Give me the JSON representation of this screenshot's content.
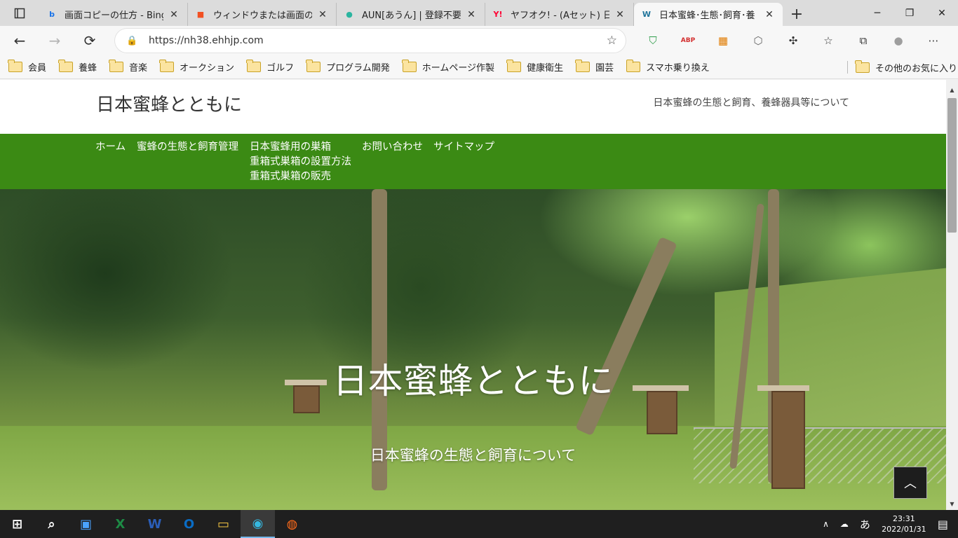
{
  "browser": {
    "tabs": [
      {
        "title": "画面コピーの仕方 - Bing",
        "fav": "b",
        "fav_color": "#1a73e8",
        "active": false
      },
      {
        "title": "ウィンドウまたは画面の内容",
        "fav": "■",
        "fav_color": "#f25022",
        "active": false
      },
      {
        "title": "AUN[あうん] | 登録不要",
        "fav": "●",
        "fav_color": "#2bb5a0",
        "active": false
      },
      {
        "title": "ヤフオク! - (Aセット) 日本",
        "fav": "Y!",
        "fav_color": "#ff0033",
        "active": false
      },
      {
        "title": "日本蜜蜂･生態･飼育･養",
        "fav": "W",
        "fav_color": "#21759b",
        "active": true
      }
    ],
    "new_tab": "+",
    "window_controls": {
      "minimize": "─",
      "restore": "❐",
      "close": "✕"
    },
    "nav": {
      "back": "←",
      "forward": "→",
      "reload": "⟳"
    },
    "url": "https://nh38.ehhjp.com",
    "lock": "🔒",
    "add_favorite": "☆",
    "extensions": [
      {
        "name": "shield-icon",
        "glyph": "⛉",
        "color": "#2e9d4a"
      },
      {
        "name": "abp-icon",
        "glyph": "ABP",
        "color": "#d32f2f"
      },
      {
        "name": "cube-icon",
        "glyph": "▦",
        "color": "#e07b00"
      },
      {
        "name": "hexagon-icon",
        "glyph": "⬡",
        "color": "#666"
      },
      {
        "name": "puzzle-icon",
        "glyph": "✣",
        "color": "#333"
      },
      {
        "name": "favorites-icon",
        "glyph": "☆",
        "color": "#333"
      },
      {
        "name": "collections-icon",
        "glyph": "⧉",
        "color": "#333"
      },
      {
        "name": "profile-icon",
        "glyph": "●",
        "color": "#9e9e9e"
      },
      {
        "name": "more-icon",
        "glyph": "⋯",
        "color": "#333"
      }
    ],
    "bookmarks": [
      "会員",
      "養蜂",
      "音楽",
      "オークション",
      "ゴルフ",
      "プログラム開発",
      "ホームページ作製",
      "健康衛生",
      "園芸",
      "スマホ乗り換え"
    ],
    "other_bookmarks": "その他のお気に入り"
  },
  "site": {
    "title": "日本蜜蜂とともに",
    "tagline": "日本蜜蜂の生態と飼育、養蜂器具等について",
    "nav": [
      {
        "label": "ホーム"
      },
      {
        "label": "蜜蜂の生態と飼育管理"
      },
      {
        "label": "日本蜜蜂用の巣箱",
        "sub": [
          "重箱式巣箱の設置方法",
          "重箱式巣箱の販売"
        ]
      },
      {
        "label": "お問い合わせ"
      },
      {
        "label": "サイトマップ"
      }
    ],
    "hero_title": "日本蜜蜂とともに",
    "hero_subtitle": "日本蜜蜂の生態と飼育について",
    "to_top": "︿"
  },
  "taskbar": {
    "apps": [
      {
        "name": "start-icon",
        "glyph": "⊞",
        "color": "#ffffff"
      },
      {
        "name": "search-icon",
        "glyph": "⌕",
        "color": "#ffffff"
      },
      {
        "name": "store-icon",
        "glyph": "▣",
        "color": "#4aa3ff"
      },
      {
        "name": "excel-icon",
        "glyph": "X",
        "color": "#1d8a45"
      },
      {
        "name": "word-icon",
        "glyph": "W",
        "color": "#2b5eb8"
      },
      {
        "name": "outlook-icon",
        "glyph": "O",
        "color": "#0a6cc4"
      },
      {
        "name": "explorer-icon",
        "glyph": "▭",
        "color": "#f4c542"
      },
      {
        "name": "edge-icon",
        "glyph": "◉",
        "color": "#35b8e0"
      },
      {
        "name": "firefox-icon",
        "glyph": "◍",
        "color": "#ff6b1a"
      }
    ],
    "tray": {
      "chevron": "∧",
      "cloud": "☁",
      "ime": "あ",
      "notification": "▤"
    },
    "time": "23:31",
    "date": "2022/01/31"
  }
}
